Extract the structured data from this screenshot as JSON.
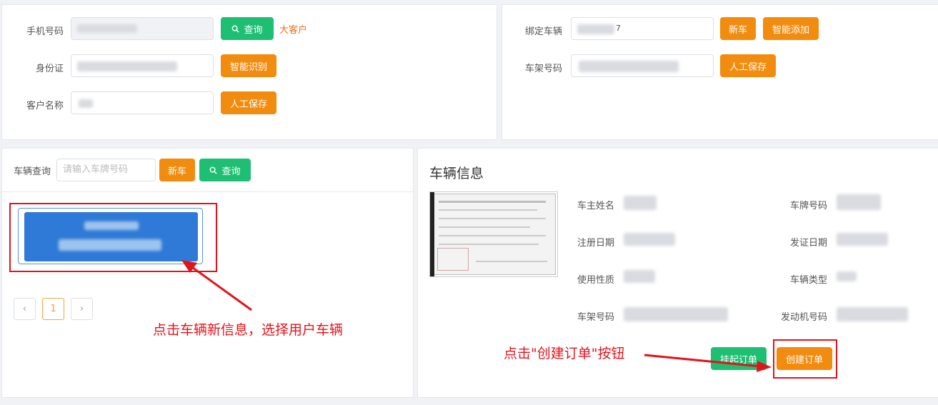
{
  "customer": {
    "phone_label": "手机号码",
    "query_label": "查询",
    "big_customer_link": "大客户",
    "id_label": "身份证",
    "smart_recognize_label": "智能识别",
    "name_label": "客户名称",
    "manual_save_label": "人工保存"
  },
  "bind": {
    "bind_vehicle_label": "绑定车辆",
    "bind_vehicle_value_suffix": "7",
    "new_car_label": "新车",
    "smart_add_label": "智能添加",
    "vin_label": "车架号码",
    "manual_save_label": "人工保存"
  },
  "vehicle_search": {
    "label": "车辆查询",
    "placeholder": "请输入车牌号码",
    "new_car_label": "新车",
    "query_label": "查询",
    "current_page": "1"
  },
  "vehicle_info": {
    "title": "车辆信息",
    "fields": {
      "owner_name": "车主姓名",
      "plate_no": "车牌号码",
      "register_date": "注册日期",
      "issue_date": "发证日期",
      "use_nature": "使用性质",
      "vehicle_type": "车辆类型",
      "vin": "车架号码",
      "engine_no": "发动机号码"
    },
    "suspend_order_label": "挂起订单",
    "create_order_label": "创建订单"
  },
  "annotations": {
    "select_vehicle": "点击车辆新信息，选择用户车辆",
    "create_order": "点击\"创建订单\"按钮"
  },
  "colors": {
    "orange": "#f28c0f",
    "green": "#1fbf73",
    "blue_card": "#2f7ad6",
    "annotation_red": "#e1141c"
  }
}
